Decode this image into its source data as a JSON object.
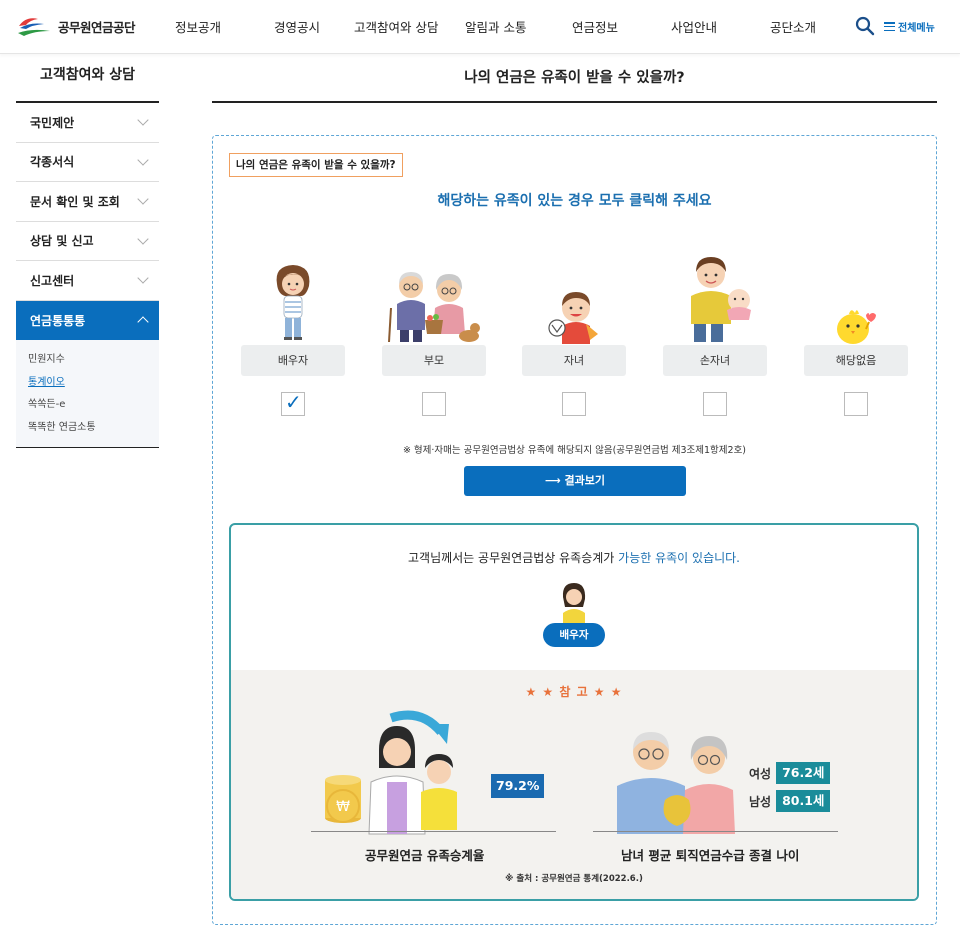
{
  "header": {
    "logo_text": "공무원연금공단",
    "nav": [
      "정보공개",
      "경영공시",
      "고객참여와 상담",
      "알림과 소통",
      "연금정보",
      "사업안내",
      "공단소개"
    ],
    "all_menu_label": "전체메뉴"
  },
  "sidebar": {
    "title": "고객참여와 상담",
    "items": [
      {
        "label": "국민제안"
      },
      {
        "label": "각종서식"
      },
      {
        "label": "문서 확인 및 조회"
      },
      {
        "label": "상담 및 신고"
      },
      {
        "label": "신고센터"
      },
      {
        "label": "연금통통통"
      }
    ],
    "sub_items": [
      "민원지수",
      "통계이오",
      "쏙쏙든-e",
      "똑똑한 연금소통"
    ]
  },
  "main": {
    "page_title": "나의 연금은 유족이 받을 수 있을까?",
    "tag": "나의 연금은 유족이 받을 수 있을까?",
    "instruction": "해당하는 유족이 있는 경우 모두 클릭해 주세요",
    "options": [
      {
        "label": "배우자",
        "checked": true
      },
      {
        "label": "부모",
        "checked": false
      },
      {
        "label": "자녀",
        "checked": false
      },
      {
        "label": "손자녀",
        "checked": false
      },
      {
        "label": "해당없음",
        "checked": false
      }
    ],
    "check_mark": "✓",
    "note": "※ 형제·자매는 공무원연금법상 유족에 해당되지 않음(공무원연금법 제3조제1항제2호)",
    "result_button": "⟶ 결과보기"
  },
  "result": {
    "message_pre": "고객님께서는 공무원연금법상 유족승계가 ",
    "message_hl": "가능한 유족이 있습니다.",
    "badge": "배우자",
    "ref_title": "★ ★ 참 고 ★ ★",
    "succession_rate": "79.2%",
    "succession_caption": "공무원연금 유족승계율",
    "female_label": "여성",
    "female_age": "76.2세",
    "male_label": "남성",
    "male_age": "80.1세",
    "age_caption": "남녀 평균 퇴직연금수급 종결 나이",
    "source": "※ 출처 : 공무원연금 통계(2022.6.)",
    "coin_symbol": "₩"
  },
  "colors": {
    "primary": "#0a6ebd",
    "accent_text": "#1b6fb0",
    "teal": "#1a8c9a",
    "ref_star": "#e8723b"
  }
}
